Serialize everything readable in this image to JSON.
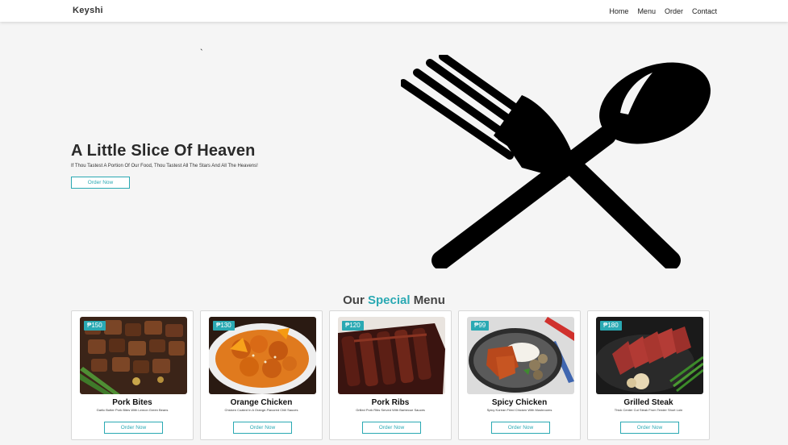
{
  "nav": {
    "brand": "Keyshi",
    "links": [
      "Home",
      "Menu",
      "Order",
      "Contact"
    ]
  },
  "hero": {
    "stray_mark": "`",
    "title": "A Little Slice Of Heaven",
    "subtitle": "If Thou Tastest A Portion Of Our Food, Thou Tastest All The Stars And All The Heavens!",
    "button_label": "Order Now",
    "art_icon": "fork-and-spoon-icon"
  },
  "menu_section": {
    "title_before": "Our",
    "title_accent": "Special",
    "title_after": "Menu"
  },
  "cards": [
    {
      "price": "₱150",
      "name": "Pork Bites",
      "description": "Garlic Butter Pork Bites With Lemon Green Beans",
      "button": "Order Now"
    },
    {
      "price": "₱130",
      "name": "Orange Chicken",
      "description": "Chicken Coated In A Orange-Flavored Chili Sauces",
      "button": "Order Now"
    },
    {
      "price": "₱120",
      "name": "Pork Ribs",
      "description": "Grilled Pork Ribs Served With Barbecue Sauces",
      "button": "Order Now"
    },
    {
      "price": "₱99",
      "name": "Spicy Chicken",
      "description": "Spicy Korean Fried Chicken With Mushrooms",
      "button": "Order Now"
    },
    {
      "price": "₱180",
      "name": "Grilled Steak",
      "description": "Thick Center Cut Steak From Tender Short Loin",
      "button": "Order Now"
    }
  ],
  "colors": {
    "accent": "#2aa9b3",
    "background": "#f5f5f5",
    "navbar": "#ffffff"
  }
}
